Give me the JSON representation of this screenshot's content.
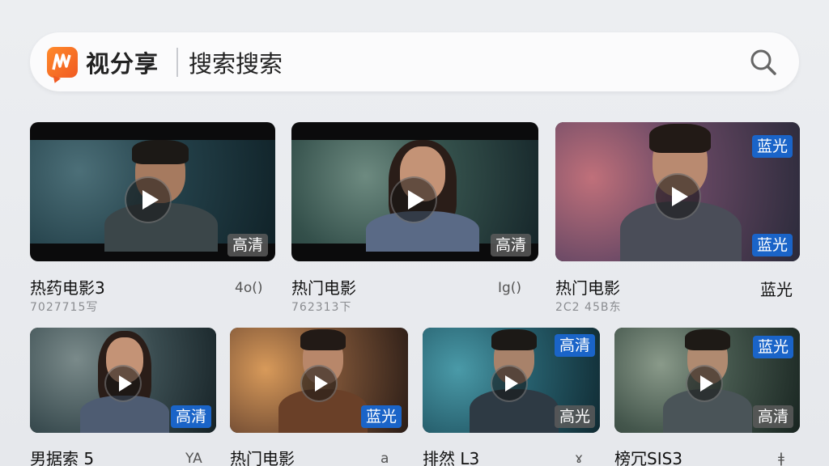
{
  "app": {
    "name": "视分享",
    "search_text": "搜索搜索",
    "accent": "#f05a22"
  },
  "row1": [
    {
      "title": "热药电影3",
      "meta": "7027715写",
      "right": "4o()",
      "badges": [
        "高清"
      ]
    },
    {
      "title": "热门电影",
      "meta": "762313下",
      "right": "Ig()",
      "badges": [
        "高清"
      ]
    },
    {
      "title": "热门电影",
      "meta": "2C2 45B东",
      "right": "蓝光",
      "badges": [
        "蓝光",
        "蓝光"
      ]
    }
  ],
  "row2": [
    {
      "title": "男据索 5",
      "right": "YA",
      "badges": [
        "高清"
      ]
    },
    {
      "title": "热门电影",
      "right": "a",
      "badges": [
        "蓝光"
      ]
    },
    {
      "title": "排然 L3",
      "right": "ɤ",
      "badges": [
        "高清",
        "高光"
      ]
    },
    {
      "title": "榜冗SIS3",
      "right": "ǂ",
      "badges": [
        "蓝光",
        "高清"
      ]
    }
  ],
  "colors": {
    "badge_blue": "#1a64c8",
    "badge_gray": "#5a5a5a"
  }
}
